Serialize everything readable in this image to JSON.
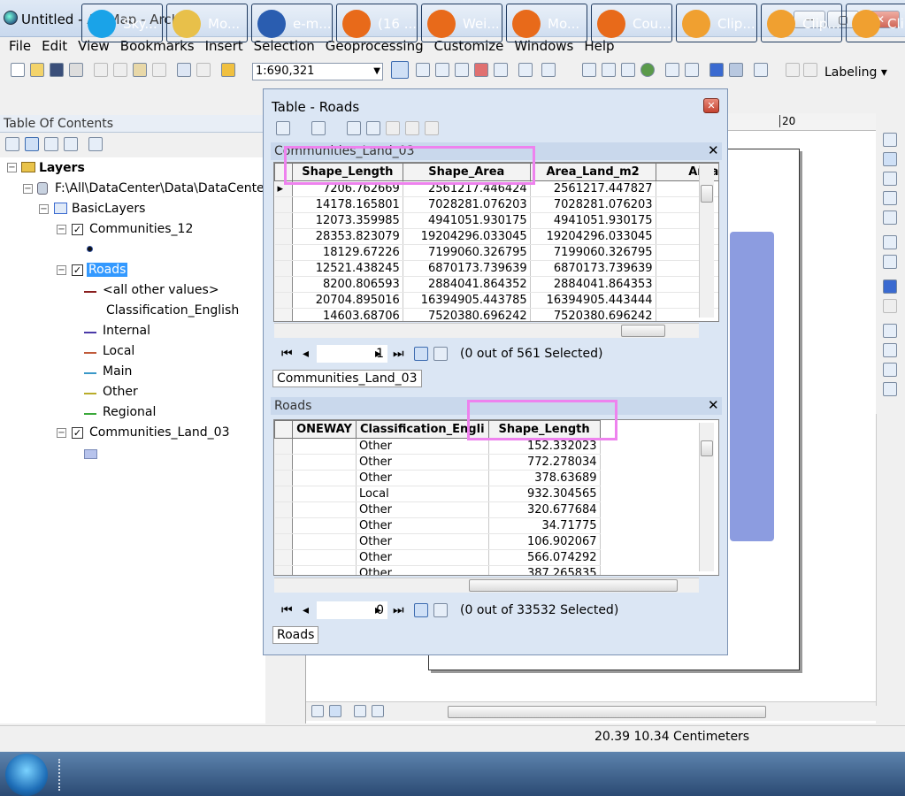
{
  "app": {
    "title": "Untitled - ArcMap - ArcInfo"
  },
  "window_controls": {
    "minimize": "—",
    "maximize": "▢",
    "close": "✕"
  },
  "menu": [
    "File",
    "Edit",
    "View",
    "Bookmarks",
    "Insert",
    "Selection",
    "Geoprocessing",
    "Customize",
    "Windows",
    "Help"
  ],
  "toolbar": {
    "scale": "1:690,321",
    "labeling": "Labeling"
  },
  "toc": {
    "header": "Table Of Contents",
    "layers_label": "Layers",
    "path": "F:\\All\\DataCenter\\Data\\DataCenter",
    "group": "BasicLayers",
    "layer1": "Communities_12",
    "layer2": "Roads",
    "legend_other_values": "<all other values>",
    "legend_field": "Classification_English",
    "legend_items": [
      {
        "label": "Internal",
        "color": "#4b3aa8"
      },
      {
        "label": "Local",
        "color": "#c05a3a"
      },
      {
        "label": "Main",
        "color": "#3a98c8"
      },
      {
        "label": "Other",
        "color": "#b9ac2a"
      },
      {
        "label": "Regional",
        "color": "#3aa83a"
      }
    ],
    "other_values_color": "#8a1f1f",
    "layer3": "Communities_Land_03"
  },
  "table_window": {
    "title": "Table - Roads",
    "communities": {
      "title": "Communities_Land_03",
      "columns": [
        "Shape_Length",
        "Shape_Area",
        "Area_Land_m2",
        "Area"
      ],
      "rows": [
        [
          "7206.762669",
          "2561217.446424",
          "2561217.447827"
        ],
        [
          "14178.165801",
          "7028281.076203",
          "7028281.076203"
        ],
        [
          "12073.359985",
          "4941051.930175",
          "4941051.930175"
        ],
        [
          "28353.823079",
          "19204296.033045",
          "19204296.033045"
        ],
        [
          "18129.67226",
          "7199060.326795",
          "7199060.326795"
        ],
        [
          "12521.438245",
          "6870173.739639",
          "6870173.739639"
        ],
        [
          "8200.806593",
          "2884041.864352",
          "2884041.864353"
        ],
        [
          "20704.895016",
          "16394905.443785",
          "16394905.443444"
        ],
        [
          "14603.68706",
          "7520380.696242",
          "7520380.696242"
        ]
      ],
      "record": "1",
      "selected_text": "(0 out of 561 Selected)",
      "tab": "Communities_Land_03"
    },
    "roads": {
      "title": "Roads",
      "columns": [
        "ONEWAY",
        "Classification_Engli",
        "Shape_Length"
      ],
      "rows": [
        [
          "",
          "Other",
          "152.332023"
        ],
        [
          "",
          "Other",
          "772.278034"
        ],
        [
          "",
          "Other",
          "378.63689"
        ],
        [
          "",
          "Local",
          "932.304565"
        ],
        [
          "",
          "Other",
          "320.677684"
        ],
        [
          "",
          "Other",
          "34.71775"
        ],
        [
          "",
          "Other",
          "106.902067"
        ],
        [
          "",
          "Other",
          "566.074292"
        ],
        [
          "",
          "Other",
          "387.265835"
        ]
      ],
      "record": "0",
      "selected_text": "(0 out of 33532 Selected)",
      "tab": "Roads"
    }
  },
  "map": {
    "ruler_mark": "20"
  },
  "status": {
    "coords": "20.39  10.34 Centimeters"
  },
  "taskbar": [
    {
      "label": "Sky...",
      "color": "#1aa3e8"
    },
    {
      "label": "Mo...",
      "color": "#e8c04a"
    },
    {
      "label": "e-m...",
      "color": "#2a5db0"
    },
    {
      "label": "(16 ...",
      "color": "#e86a1a"
    },
    {
      "label": "Wei...",
      "color": "#e86a1a"
    },
    {
      "label": "Mo...",
      "color": "#e86a1a"
    },
    {
      "label": "Cou...",
      "color": "#e86a1a"
    },
    {
      "label": "Clip...",
      "color": "#f0a030"
    },
    {
      "label": "Clip...",
      "color": "#f0a030"
    },
    {
      "label": "Cli",
      "color": "#f0a030"
    }
  ]
}
